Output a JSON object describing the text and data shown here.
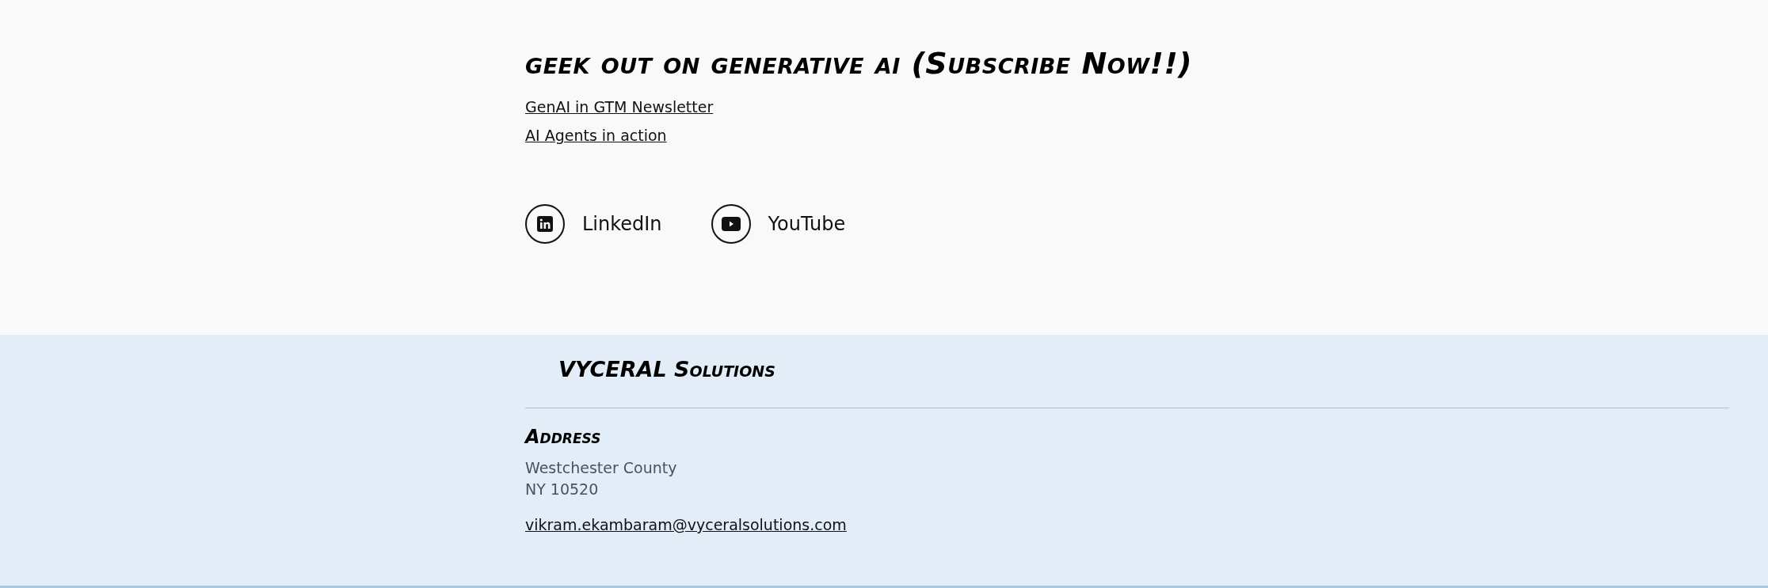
{
  "subscribe": {
    "heading": "geek out on generative ai (Subscribe Now!!)",
    "links": [
      "GenAI in GTM Newsletter",
      "AI Agents in action"
    ]
  },
  "social": [
    {
      "kind": "linkedin",
      "label": "LinkedIn"
    },
    {
      "kind": "youtube",
      "label": "YouTube"
    }
  ],
  "footer": {
    "brand": "VYCERAL Solutions",
    "address_heading": "Address",
    "address_lines": [
      "Westchester County",
      "NY 10520"
    ],
    "email": "vikram.ekambaram@vyceralsolutions.com"
  }
}
